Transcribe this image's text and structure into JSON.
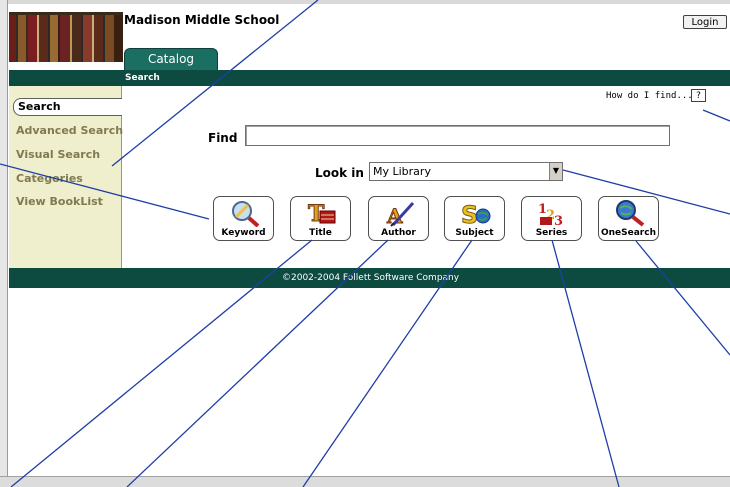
{
  "header": {
    "school_name": "Madison Middle School",
    "login_label": "Login"
  },
  "tabs": [
    {
      "label": "Catalog"
    }
  ],
  "subnav": {
    "label": "Search"
  },
  "sidebar": {
    "items": [
      {
        "label": "Search",
        "active": true
      },
      {
        "label": "Advanced Search"
      },
      {
        "label": "Visual Search"
      },
      {
        "label": "Categories"
      },
      {
        "label": "View BookList"
      }
    ]
  },
  "help": {
    "label": "How do I find...",
    "icon_text": "?"
  },
  "find": {
    "label": "Find",
    "value": ""
  },
  "look_in": {
    "label": "Look in",
    "selected": "My Library"
  },
  "search_buttons": [
    {
      "label": "Keyword",
      "icon": "keyword-icon"
    },
    {
      "label": "Title",
      "icon": "title-icon"
    },
    {
      "label": "Author",
      "icon": "author-icon"
    },
    {
      "label": "Subject",
      "icon": "subject-icon"
    },
    {
      "label": "Series",
      "icon": "series-icon"
    },
    {
      "label": "OneSearch",
      "icon": "onesearch-icon"
    }
  ],
  "footer": {
    "text": "©2002-2004 Follett Software Company"
  },
  "colors": {
    "brand_green": "#0d4a40",
    "tab_green": "#1a6e62",
    "sidebar_bg": "#efeecd",
    "sidebar_text": "#807a50",
    "callout_line": "#1f3fa8"
  }
}
